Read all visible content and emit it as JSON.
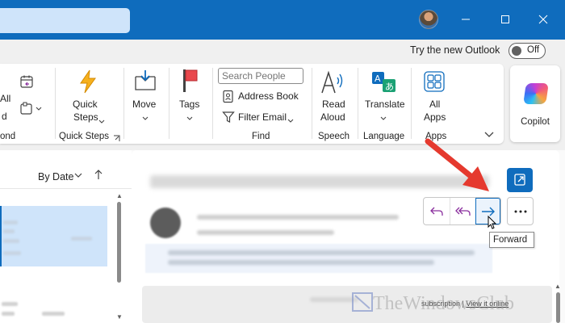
{
  "window": {
    "minimize_icon": "minimize-icon",
    "maximize_icon": "maximize-icon",
    "close_icon": "close-icon"
  },
  "header": {
    "try_new_label": "Try the new Outlook",
    "toggle_state": "Off"
  },
  "ribbon": {
    "partial_all_label": "All",
    "partial_d_label": "d",
    "partial_group_label": "ond",
    "quick_steps_label_1": "Quick",
    "quick_steps_label_2": "Steps",
    "quick_steps_group": "Quick Steps",
    "move_label": "Move",
    "tags_label": "Tags",
    "search_people_placeholder": "Search People",
    "address_book_label": "Address Book",
    "filter_email_label": "Filter Email",
    "find_group": "Find",
    "read_aloud_label_1": "Read",
    "read_aloud_label_2": "Aloud",
    "speech_group": "Speech",
    "translate_label": "Translate",
    "language_group": "Language",
    "all_apps_label_1": "All",
    "all_apps_label_2": "Apps",
    "apps_group": "Apps",
    "copilot_label": "Copilot"
  },
  "mail_list": {
    "sort_label": "By Date"
  },
  "reading": {
    "tooltip": "Forward",
    "unsubscribe_text": "subscription",
    "view_online": "View it online",
    "separator": "|"
  },
  "colors": {
    "brand": "#0f6cbd",
    "annotation_arrow": "#e5392e"
  },
  "watermark": "TheWindowsClub"
}
